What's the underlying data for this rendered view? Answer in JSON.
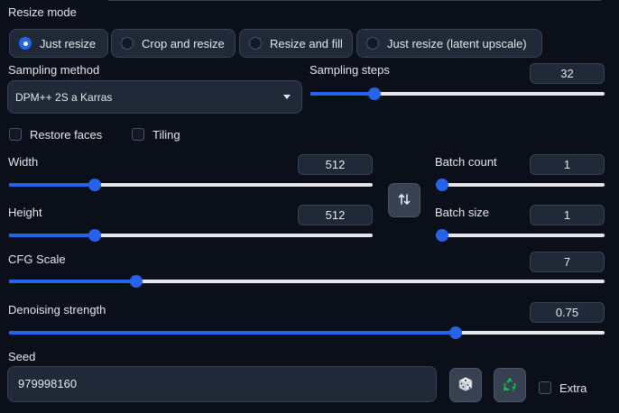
{
  "resize_mode": {
    "label": "Resize mode",
    "options": [
      {
        "label": "Just resize",
        "selected": true
      },
      {
        "label": "Crop and resize",
        "selected": false
      },
      {
        "label": "Resize and fill",
        "selected": false
      },
      {
        "label": "Just resize (latent upscale)",
        "selected": false
      }
    ]
  },
  "sampling_method": {
    "label": "Sampling method",
    "value": "DPM++ 2S a Karras"
  },
  "sampling_steps": {
    "label": "Sampling steps",
    "value": "32",
    "fraction": 0.218
  },
  "restore_faces": {
    "label": "Restore faces",
    "checked": false
  },
  "tiling": {
    "label": "Tiling",
    "checked": false
  },
  "width": {
    "label": "Width",
    "value": "512",
    "fraction": 0.236
  },
  "height": {
    "label": "Height",
    "value": "512",
    "fraction": 0.236
  },
  "batch_count": {
    "label": "Batch count",
    "value": "1",
    "fraction": 0
  },
  "batch_size": {
    "label": "Batch size",
    "value": "1",
    "fraction": 0
  },
  "cfg_scale": {
    "label": "CFG Scale",
    "value": "7",
    "fraction": 0.214
  },
  "denoising": {
    "label": "Denoising strength",
    "value": "0.75",
    "fraction": 0.75
  },
  "seed": {
    "label": "Seed",
    "value": "979998160"
  },
  "extra": {
    "label": "Extra",
    "checked": false
  },
  "icons": {
    "swap": "swap-arrows-icon",
    "random": "dice-icon",
    "reuse": "recycle-icon"
  },
  "colors": {
    "accent": "#2563eb",
    "background": "#0b0f19",
    "panel": "#1f2937",
    "recycle": "#22c55e"
  }
}
